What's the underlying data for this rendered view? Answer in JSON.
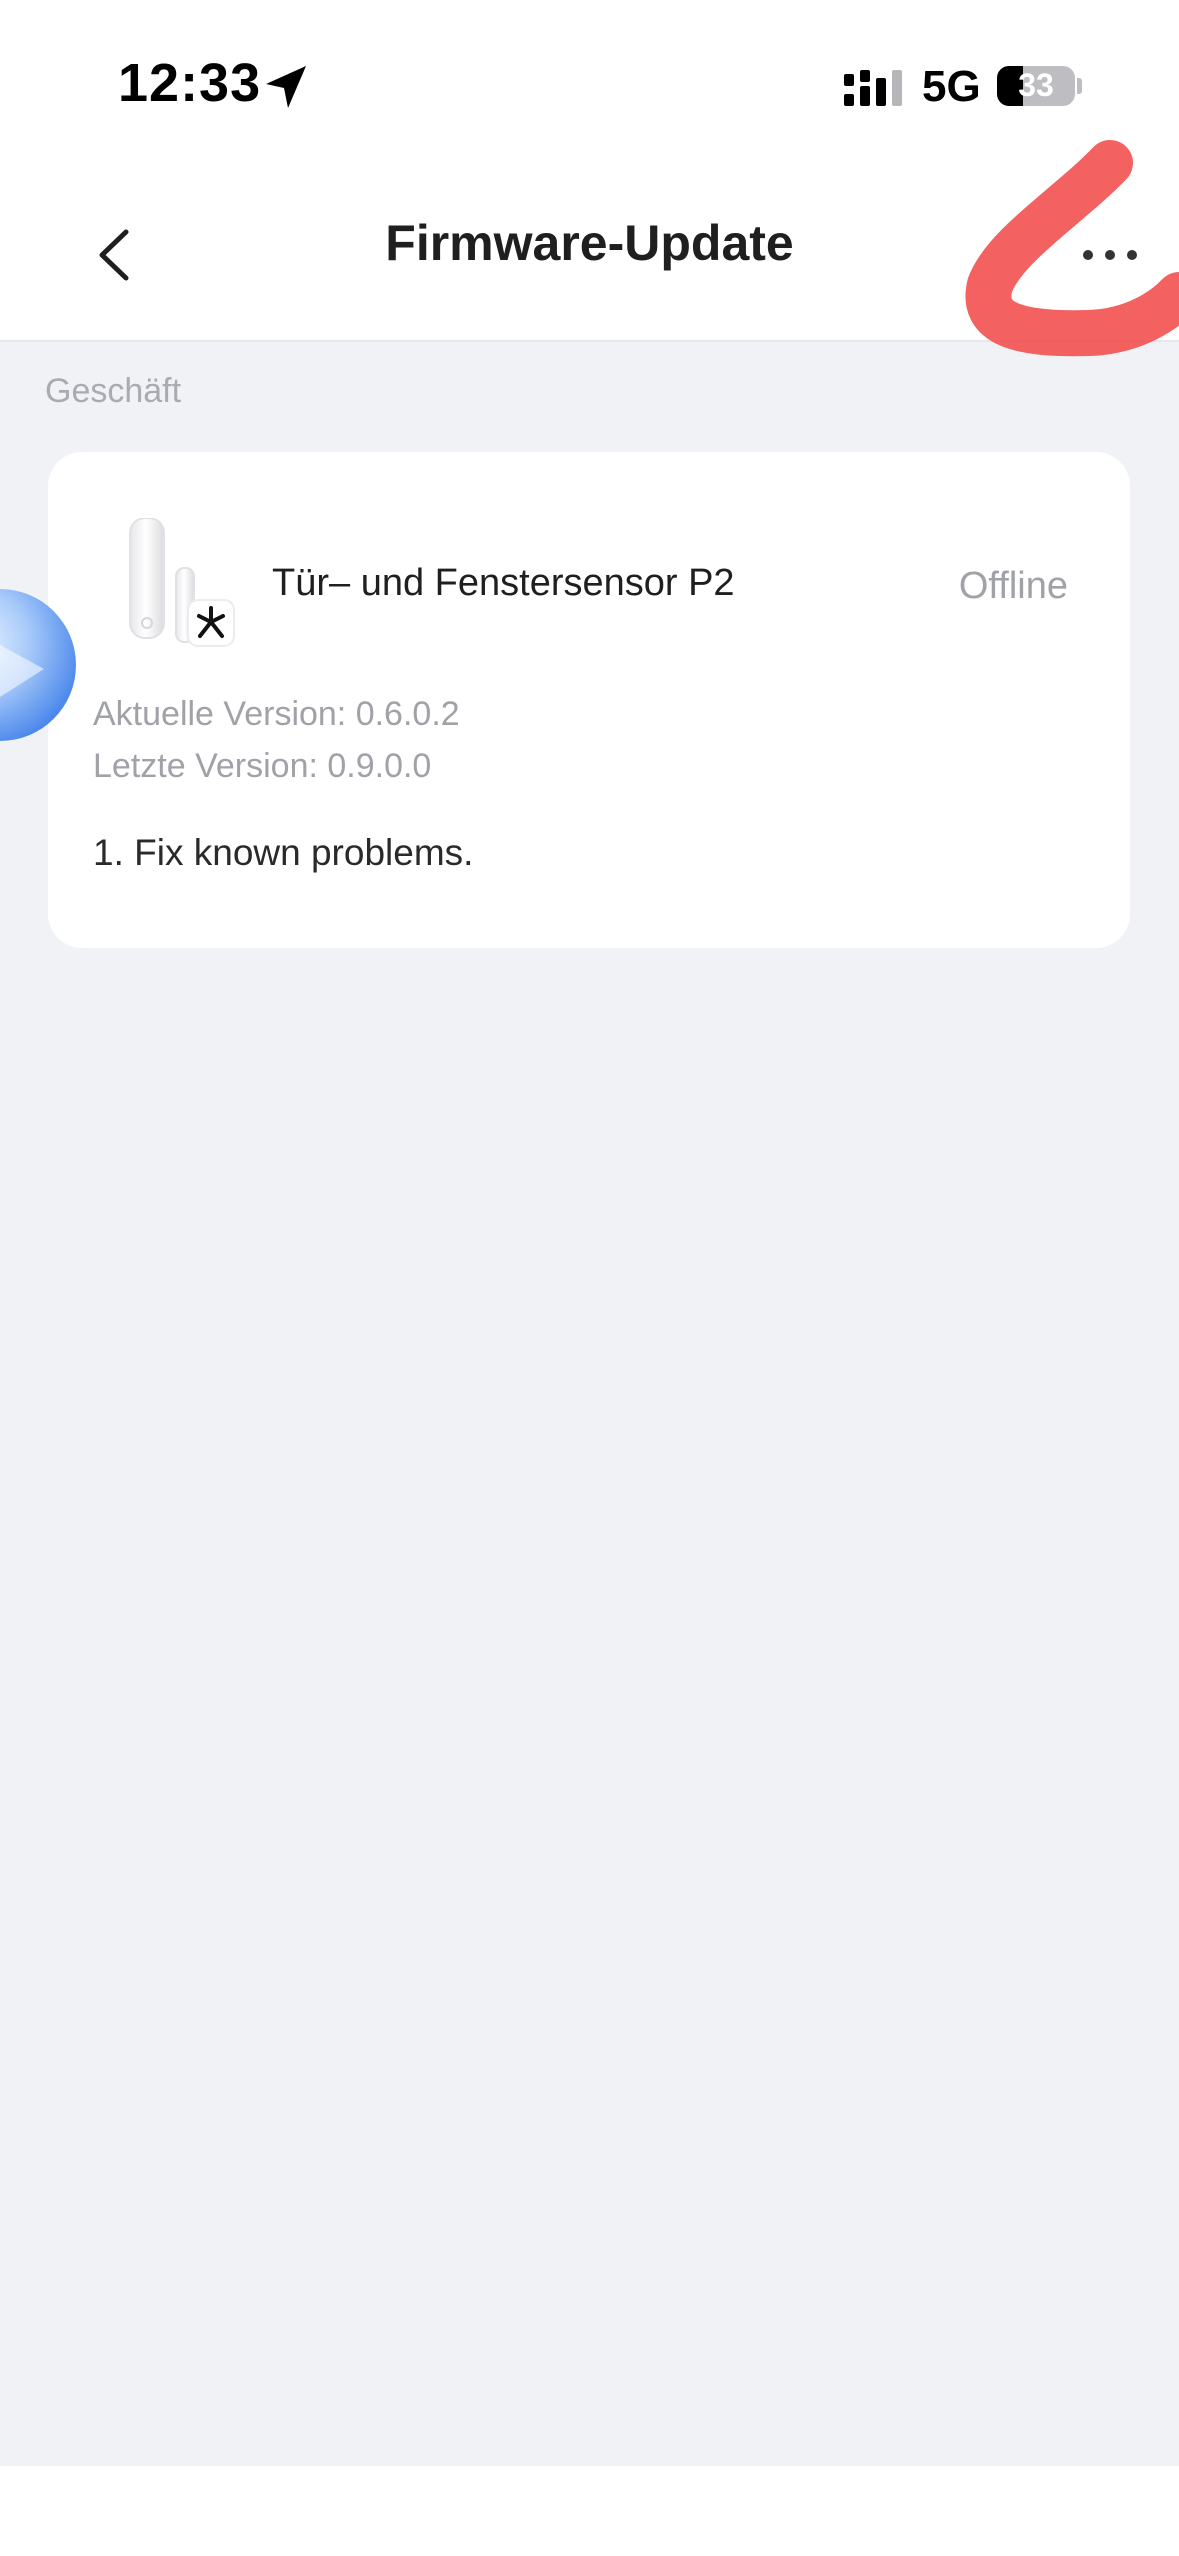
{
  "status_bar": {
    "time": "12:33",
    "network": "5G",
    "battery_level": "33",
    "battery_fraction": 0.33,
    "location_icon": "location-arrow-icon",
    "signal_icon": "cellular-signal-icon"
  },
  "header": {
    "title": "Firmware-Update",
    "back_icon": "chevron-left-icon",
    "more_icon": "ellipsis-icon"
  },
  "section": {
    "label": "Geschäft"
  },
  "device": {
    "name": "Tür– und Fenstersensor P2",
    "status": "Offline",
    "current_version": "Aktuelle Version: 0.6.0.2",
    "latest_version": "Letzte Version: 0.9.0.0",
    "release_notes": "1. Fix known problems.",
    "image_icon": "door-window-sensor-icon",
    "badge_icon": "zigbee-badge-icon"
  },
  "colors": {
    "background": "#F1F2F6",
    "card": "#FFFFFF",
    "secondary_text": "#A0A2A8",
    "annotation": "#F24B4B",
    "assistant": "#4D8DF0"
  }
}
